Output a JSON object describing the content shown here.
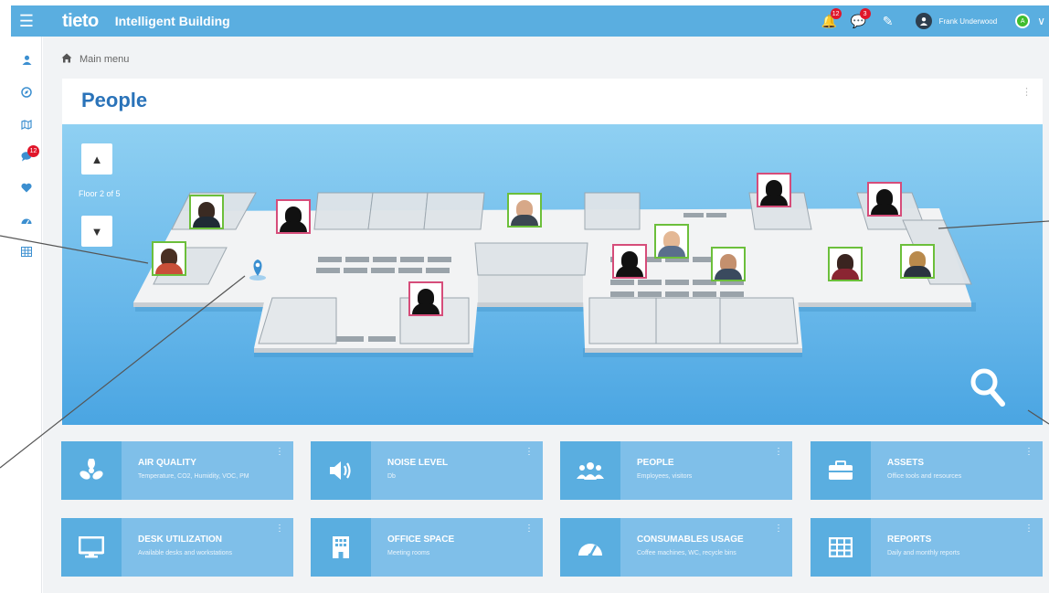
{
  "header": {
    "brand": "tieto",
    "app_name": "Intelligent Building",
    "notifications_count": "12",
    "messages_count": "3",
    "user_name": "Frank Underwood",
    "status_letter": "A"
  },
  "sidebar": {
    "items": [
      {
        "icon": "user-icon"
      },
      {
        "icon": "compass-icon"
      },
      {
        "icon": "map-icon"
      },
      {
        "icon": "chat-icon",
        "badge": "12"
      },
      {
        "icon": "heart-icon"
      },
      {
        "icon": "dashboard-icon"
      },
      {
        "icon": "table-icon"
      }
    ]
  },
  "breadcrumb": {
    "label": "Main menu"
  },
  "panel": {
    "title": "People",
    "floor_label": "Floor 2 of 5"
  },
  "colors": {
    "accent": "#5aaee0",
    "tile": "#7fbfe9",
    "title": "#2a73b9",
    "green_frame": "#6cbf3b",
    "pink_frame": "#d64d7a"
  },
  "tiles": [
    {
      "title": "AIR QUALITY",
      "subtitle": "Temperature, CO2, Humidity, VOC, PM",
      "icon": "fan-icon"
    },
    {
      "title": "NOISE LEVEL",
      "subtitle": "Db",
      "icon": "speaker-icon"
    },
    {
      "title": "PEOPLE",
      "subtitle": "Employees, visitors",
      "icon": "people-icon"
    },
    {
      "title": "ASSETS",
      "subtitle": "Office tools and resources",
      "icon": "briefcase-icon"
    },
    {
      "title": "DESK UTILIZATION",
      "subtitle": "Available desks and workstations",
      "icon": "monitor-icon"
    },
    {
      "title": "OFFICE SPACE",
      "subtitle": "Meeting rooms",
      "icon": "building-icon"
    },
    {
      "title": "CONSUMABLES USAGE",
      "subtitle": "Coffee machines, WC, recycle bins",
      "icon": "gauge-icon"
    },
    {
      "title": "REPORTS",
      "subtitle": "Daily and monthly reports",
      "icon": "grid-icon"
    }
  ]
}
